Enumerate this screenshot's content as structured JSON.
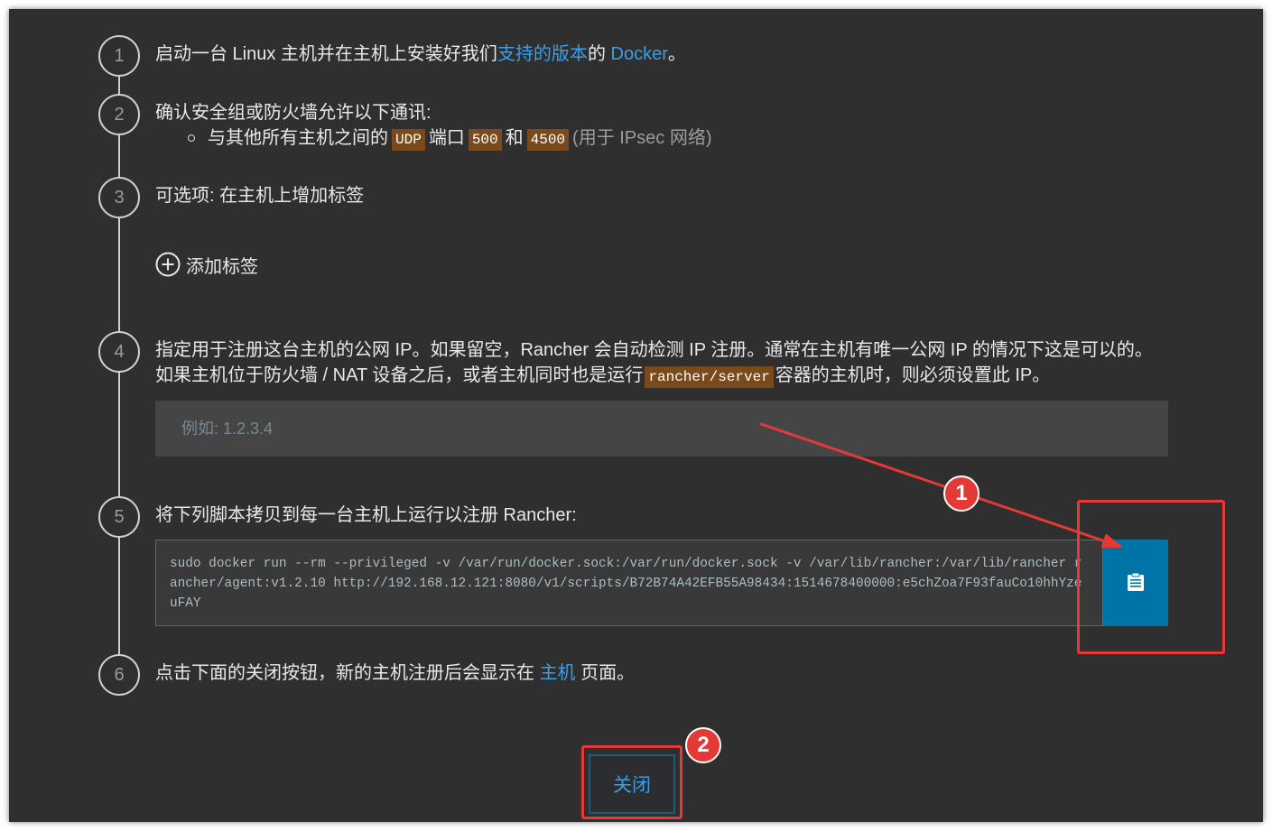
{
  "colors": {
    "panel_background": "#2f2f2f",
    "text": "#e8e8e8",
    "link": "#3a9ee8",
    "code_badge": "#7a4a1c",
    "copy_button": "#0074a6",
    "annotation": "#e53935"
  },
  "icons": {
    "add_label": "plus-circle-icon",
    "copy": "clipboard-icon"
  },
  "steps": [
    {
      "number": "1",
      "text_before": "启动一台 Linux 主机并在主机上安装好我们",
      "link_supported_versions": "支持的版本",
      "text_middle": "的",
      "link_docker": "Docker",
      "text_after": "。"
    },
    {
      "number": "2",
      "text": "确认安全组或防火墙允许以下通讯:",
      "rule": {
        "prefix": "与其他所有主机之间的",
        "protocol": "UDP",
        "port_word": "端口",
        "port_a": "500",
        "conjunction": "和",
        "port_b": "4500",
        "note": "(用于 IPsec 网络)"
      }
    },
    {
      "number": "3",
      "text": "可选项: 在主机上增加标签",
      "add_label": "添加标签"
    },
    {
      "number": "4",
      "text_before": "指定用于注册这台主机的公网 IP。如果留空，Rancher 会自动检测 IP 注册。通常在主机有唯一公网 IP 的情况下这是可以的。如果主机位于防火墙 / NAT 设备之后，或者主机同时也是运行",
      "code": "rancher/server",
      "text_after": "容器的主机时，则必须设置此 IP。",
      "ip_input": {
        "placeholder": "例如: 1.2.3.4"
      }
    },
    {
      "number": "5",
      "text": "将下列脚本拷贝到每一台主机上运行以注册 Rancher:",
      "command": "sudo docker run --rm --privileged -v /var/run/docker.sock:/var/run/docker.sock -v /var/lib/rancher:/var/lib/rancher rancher/agent:v1.2.10 http://192.168.12.121:8080/v1/scripts/B72B74A42EFB55A98434:1514678400000:e5chZoa7F93fauCo10hhYzeuFAY"
    },
    {
      "number": "6",
      "text_before": "点击下面的关闭按钮，新的主机注册后会显示在",
      "link_hosts": "主机",
      "text_after": "页面。"
    }
  ],
  "close_button": "关闭",
  "callouts": [
    "1",
    "2"
  ]
}
